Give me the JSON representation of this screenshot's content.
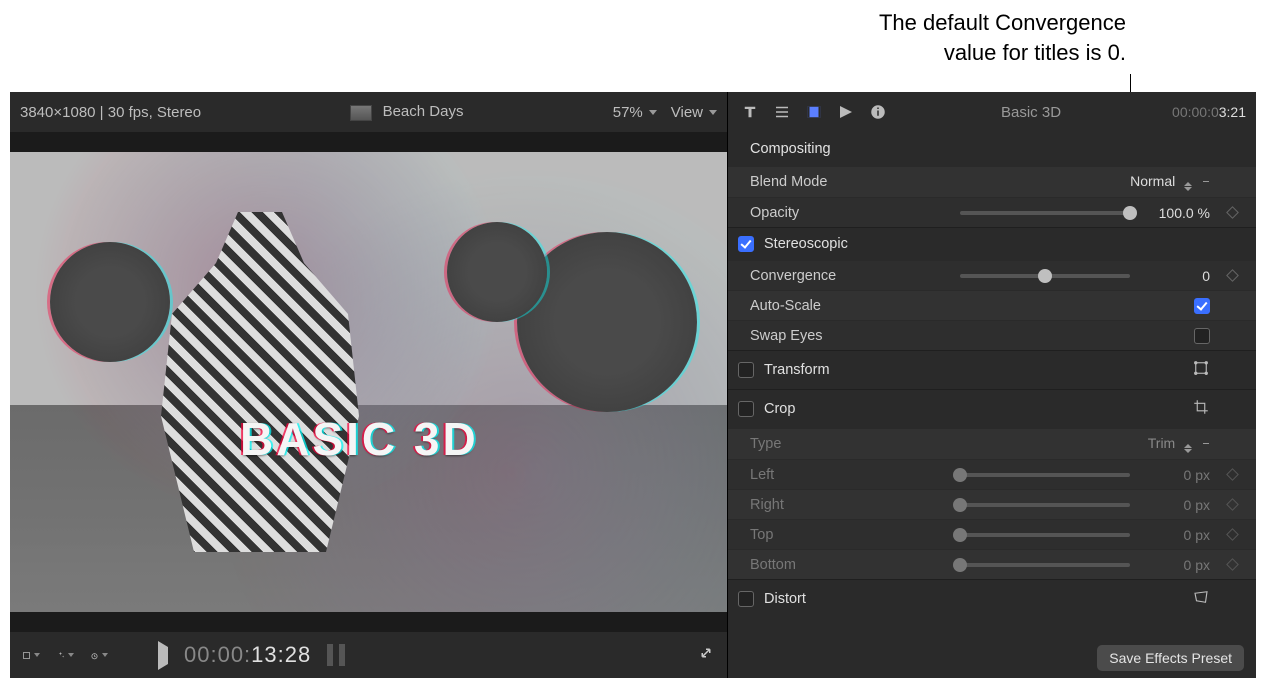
{
  "annotation": {
    "line1": "The default Convergence",
    "line2": "value for titles is 0."
  },
  "viewer": {
    "format_info": "3840×1080 | 30 fps, Stereo",
    "clip_name": "Beach Days",
    "zoom": "57%",
    "view_label": "View",
    "title_overlay": "BASIC 3D",
    "timecode_dim": "00:00:",
    "timecode_bright": "13:28"
  },
  "inspector": {
    "clip_name": "Basic 3D",
    "tc_dim": "00:00:0",
    "tc_bright": "3:21",
    "sections": {
      "compositing": {
        "header": "Compositing",
        "blend_mode": {
          "label": "Blend Mode",
          "value": "Normal"
        },
        "opacity": {
          "label": "Opacity",
          "value": "100.0 %",
          "slider_pct": 100
        }
      },
      "stereoscopic": {
        "header": "Stereoscopic",
        "checked": true,
        "convergence": {
          "label": "Convergence",
          "value": "0",
          "slider_pct": 50
        },
        "auto_scale": {
          "label": "Auto-Scale",
          "checked": true
        },
        "swap_eyes": {
          "label": "Swap Eyes",
          "checked": false
        }
      },
      "transform": {
        "header": "Transform",
        "checked": false
      },
      "crop": {
        "header": "Crop",
        "checked": false,
        "type": {
          "label": "Type",
          "value": "Trim"
        },
        "left": {
          "label": "Left",
          "value": "0 px",
          "slider_pct": 0
        },
        "right": {
          "label": "Right",
          "value": "0 px",
          "slider_pct": 0
        },
        "top": {
          "label": "Top",
          "value": "0 px",
          "slider_pct": 0
        },
        "bottom": {
          "label": "Bottom",
          "value": "0 px",
          "slider_pct": 0
        }
      },
      "distort": {
        "header": "Distort",
        "checked": false
      }
    },
    "footer_button": "Save Effects Preset"
  }
}
